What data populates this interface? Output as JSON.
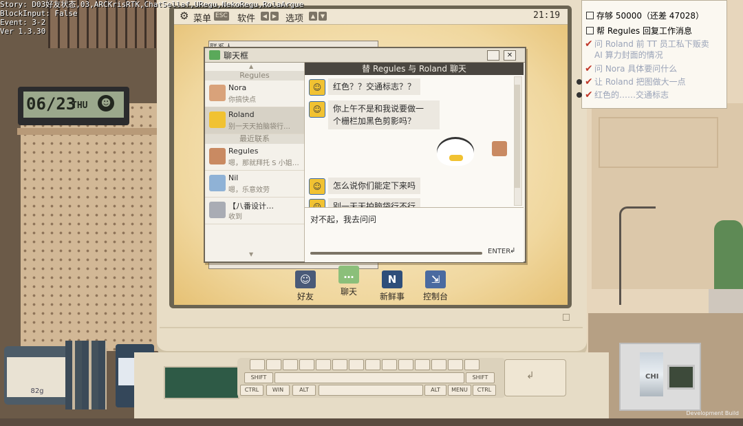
{
  "debug": {
    "lines": [
      "Story: D03好友状态,03,ARCKrisRTK,ChatSellaf,URegu,NekoRegu,RolaArgue",
      "BlockInput: False",
      "Event: 3-2",
      "Ver 1.3.30"
    ]
  },
  "desk_clock": {
    "date": "06/23",
    "day": "THU",
    "face": "☻"
  },
  "taskbar": {
    "menu_label": "菜单",
    "esc_key": "ESC",
    "software_label": "软件",
    "options_label": "选项",
    "time": "21:19"
  },
  "contacts_window": {
    "title": "联系人"
  },
  "chat_window": {
    "title": "聊天框",
    "header": "替 Regules 与 Roland 聊天",
    "contacts_head": "Regules",
    "recent_head": "最近联系",
    "contacts": [
      {
        "name": "Nora",
        "last": "你搞快点",
        "color": "#d9a27a"
      },
      {
        "name": "Roland",
        "last": "别一天天拍脑袋行…",
        "color": "#f1c232"
      }
    ],
    "recent": [
      {
        "name": "Regules",
        "last": "嗯，那就拜托 S 小姐…",
        "color": "#c98a62"
      },
      {
        "name": "Nil",
        "last": "嗯，乐意效劳",
        "color": "#8fb2d6"
      },
      {
        "name": "【八番设计…",
        "last": "收到",
        "color": "#a9acb4"
      }
    ],
    "messages": [
      {
        "from": "Roland",
        "text": "红色？？交通标志？？"
      },
      {
        "from": "Roland",
        "text": "你上午不是和我说要做一\n个栅栏加黑色剪影吗？"
      },
      {
        "from": "Roland",
        "text": "怎么说你们能定下来吗"
      },
      {
        "from": "Roland",
        "text": "别一天天拍脑袋行不行"
      }
    ],
    "input_text": "对不起，我去问问",
    "enter_label": "ENTER"
  },
  "apps": [
    {
      "label": "好友",
      "icon": "friends-icon",
      "color": "#4a5a78"
    },
    {
      "label": "聊天",
      "icon": "chat-icon",
      "color": "#8bbf7a"
    },
    {
      "label": "新鲜事",
      "icon": "news-icon",
      "color": "#2e4e7a"
    },
    {
      "label": "控制台",
      "icon": "console-icon",
      "color": "#4a6aa0"
    }
  ],
  "tasks": [
    {
      "text": "存够 50000（还差 47028）",
      "done": false
    },
    {
      "text": "帮 Regules 回复工作消息",
      "done": false
    },
    {
      "text": "问 Roland 前 TT 员工私下贩卖 AI 算力封面的情况",
      "done": true
    },
    {
      "text": "问 Nora 具体要问什么",
      "done": true
    },
    {
      "text": "让 Roland 把图做大一点",
      "done": true
    },
    {
      "text": "红色的……交通标志",
      "done": true
    }
  ],
  "mug_label": "82g",
  "keyboard": {
    "ctrl_left": "CTRL",
    "win": "WIN",
    "alt_left": "ALT",
    "alt_right": "ALT",
    "menu": "MENU",
    "ctrl_right": "CTRL",
    "shift_left": "SHIFT",
    "shift_right": "SHIFT"
  },
  "device_label": "CHI",
  "build_label": "Development Build"
}
